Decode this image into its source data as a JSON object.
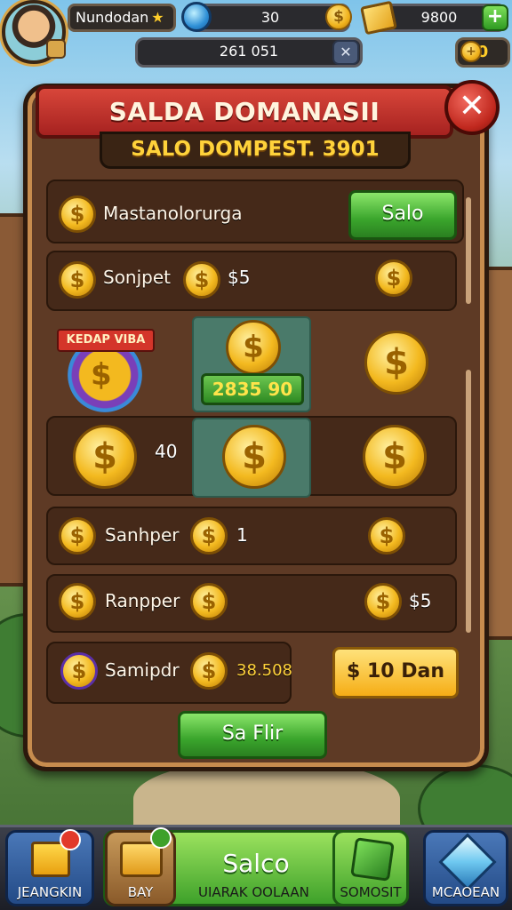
{
  "top_bar": {
    "player_name": "Nundodan",
    "star": "★",
    "gems": "30",
    "gold": "9800",
    "plus": "+",
    "timer": "261 051",
    "timer_close": "✕",
    "mini_counter": "0"
  },
  "panel": {
    "title": "SALDA DOMANASII",
    "close": "✕",
    "subtitle": "SALO DOMPEST. 3901",
    "rows": [
      {
        "label": "Mastanolorurga",
        "button": "Salo"
      },
      {
        "label": "Sonjpet",
        "extra": "$5"
      },
      {
        "badge": "KEDAP VIBA",
        "value": "2835 90"
      },
      {
        "extra": "40"
      },
      {
        "label": "Sanhper",
        "extra": "1"
      },
      {
        "label": "Ranpper",
        "extra": "$5"
      },
      {
        "label": "Samipdr",
        "value": "38.508",
        "button": "$ 10 Dan"
      }
    ],
    "confirm_button": "Sa Flir",
    "coin_symbol": "$"
  },
  "bottom_nav": {
    "items": [
      {
        "label": "JEANGKIN"
      },
      {
        "label": "BAY"
      },
      {
        "title": "Salco",
        "sub_label": "UIARAK OOLAAN"
      },
      {
        "label": "SOMOSIT"
      },
      {
        "label": "MCAOEAN"
      }
    ]
  }
}
